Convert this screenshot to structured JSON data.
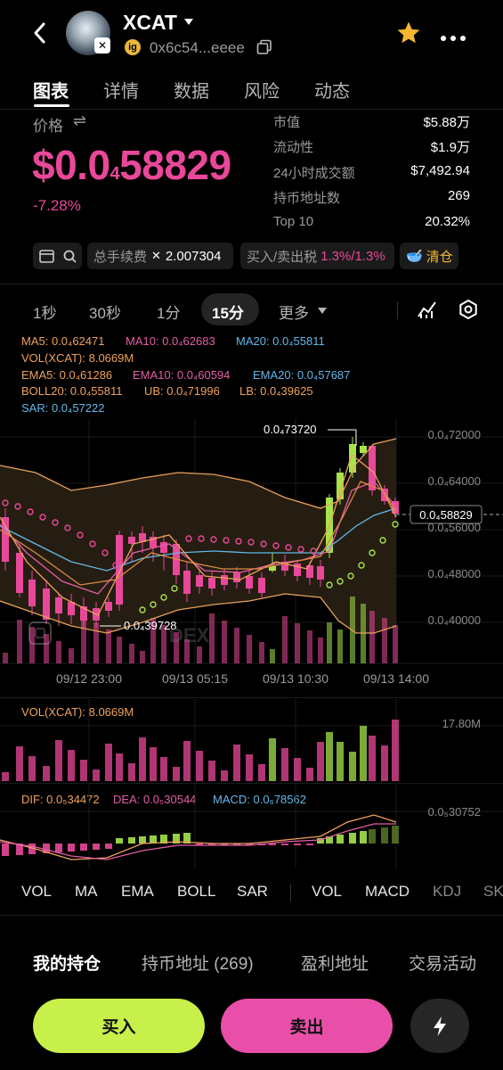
{
  "header": {
    "token_name": "XCAT",
    "address": "0x6c54...eeee",
    "chain_badge": "ig"
  },
  "tabs": [
    "图表",
    "详情",
    "数据",
    "风险",
    "动态"
  ],
  "price_section": {
    "label": "价格",
    "price_main": "$0.0",
    "price_sub": "4",
    "price_tail": "58829",
    "change": "-7.28%"
  },
  "stats": [
    {
      "label": "市值",
      "value": "$5.88万"
    },
    {
      "label": "流动性",
      "value": "$1.9万"
    },
    {
      "label": "24小时成交额",
      "value": "$7,492.94"
    },
    {
      "label": "持币地址数",
      "value": "269"
    },
    {
      "label": "Top 10",
      "value": "20.32%"
    }
  ],
  "chips": {
    "fee_label": "总手续费",
    "fee_value": "2.007304",
    "tax_label": "买入/卖出税",
    "tax_value": "1.3%/1.3%",
    "clear_label": "清仓"
  },
  "timeframes": [
    "1秒",
    "30秒",
    "1分",
    "15分",
    "更多"
  ],
  "active_timeframe": "15分",
  "legend": {
    "ma5": "MA5: 0.0₄62471",
    "ma10": "MA10: 0.0₄62683",
    "ma20": "MA20: 0.0₄55811",
    "vol": "VOL(XCAT): 8.0669M",
    "ema5": "EMA5: 0.0₄61286",
    "ema10": "EMA10: 0.0₄60594",
    "ema20": "EMA20: 0.0₄57687",
    "boll": "BOLL20: 0.0₄55811",
    "ub": "UB: 0.0₄71996",
    "lb": "LB: 0.0₄39625",
    "sar": "SAR: 0.0₄57222"
  },
  "price_axis": [
    "0.0₄72000",
    "0.0₄64000",
    "0.0₄56000",
    "0.0₄48000",
    "0.0₄40000"
  ],
  "current_price_tag": "0.0₄58829",
  "high_label": "0.0₄73720",
  "low_label": "0.0₄39728",
  "time_axis": [
    "09/12 23:00",
    "09/13 05:15",
    "09/13 10:30",
    "09/13 14:00"
  ],
  "watermark": "DEX",
  "volume_panel": {
    "label": "VOL(XCAT): 8.0669M",
    "axis": "17.80M"
  },
  "macd_panel": {
    "dif": "DIF: 0.0₅34472",
    "dea": "DEA: 0.0₅30544",
    "macd": "MACD: 0.0₆78562",
    "axis": "0.0₅30752"
  },
  "indicators": [
    "VOL",
    "MA",
    "EMA",
    "BOLL",
    "SAR",
    "VOL",
    "MACD",
    "KDJ",
    "SK"
  ],
  "bottom_tabs": [
    "我的持仓",
    "持币地址 (269)",
    "盈利地址",
    "交易活动"
  ],
  "buttons": {
    "buy": "买入",
    "sell": "卖出"
  },
  "colors": {
    "up": "#a6e34a",
    "down": "#e9489a",
    "accent": "#c8f04a",
    "sell": "#e94fa8"
  }
}
